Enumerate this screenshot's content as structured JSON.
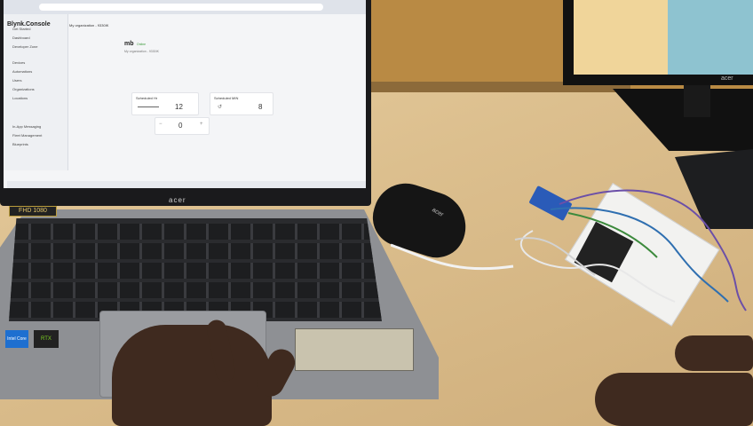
{
  "scene": "photo of a laptop showing an IoT dashboard next to a breadboard circuit",
  "browser": {
    "app_title": "Blynk.Console",
    "org": "My organization - 9330IK"
  },
  "sidebar": {
    "items": [
      {
        "label": "Get Started"
      },
      {
        "label": "Dashboard"
      },
      {
        "label": "Developer Zone"
      },
      {
        "label": "Devices"
      },
      {
        "label": "Automations"
      },
      {
        "label": "Users"
      },
      {
        "label": "Organizations"
      },
      {
        "label": "Locations"
      },
      {
        "label": "In-App Messaging"
      },
      {
        "label": "Fleet Management"
      },
      {
        "label": "Blueprints"
      }
    ]
  },
  "device": {
    "name": "mb",
    "status": "Online",
    "org_line": "My organization - 9330IK"
  },
  "widgets": [
    {
      "title": "Scheduled Hr",
      "value": "12"
    },
    {
      "title": "Scheduled MIN",
      "value": "8"
    },
    {
      "title": "",
      "value": "0"
    }
  ],
  "laptop": {
    "brand": "acer",
    "badge": "FHD 1080",
    "stickers": [
      "Intel Core",
      "RTX"
    ]
  },
  "mouse": {
    "brand": "acer"
  },
  "monitor": {
    "brand": "acer"
  },
  "colors": {
    "desk": "#dcbf8e",
    "wall": "#b98a44",
    "breadboard": "#f2f2f0",
    "esp_board": "#222222",
    "sensor": "#2a5bb8"
  }
}
